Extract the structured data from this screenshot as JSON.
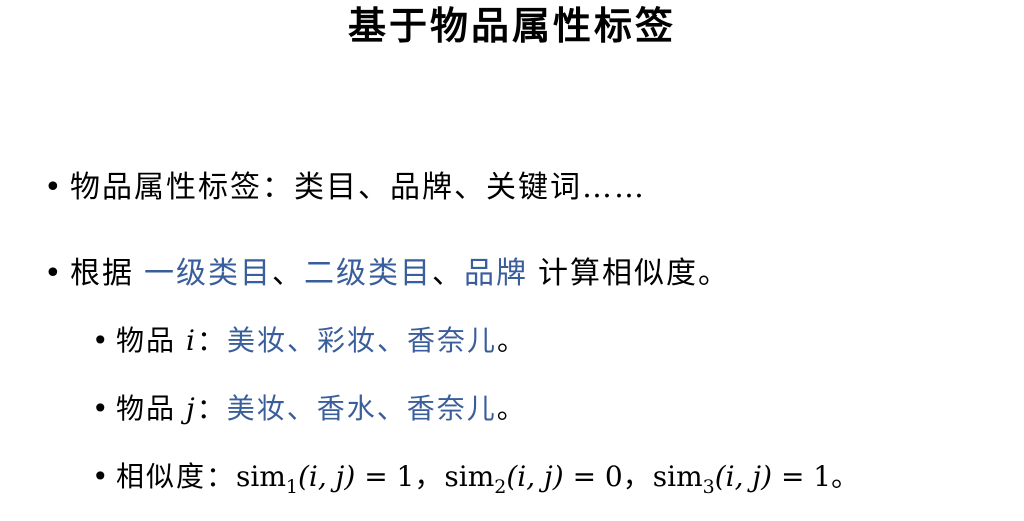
{
  "title": "基于物品属性标签",
  "bullets": {
    "b1": {
      "marker": "•",
      "text": "物品属性标签：类目、品牌、关键词……"
    },
    "b2": {
      "marker": "•",
      "prefix": "根据",
      "term1": "一级类目",
      "sep1": "、",
      "term2": "二级类目",
      "sep2": "、",
      "term3": "品牌",
      "suffix": "计算相似度。"
    }
  },
  "sub_bullets": {
    "s1": {
      "marker": "•",
      "label": "物品",
      "var": "i",
      "colon": "：",
      "values": "美妆、彩妆、香奈儿",
      "end": "。"
    },
    "s2": {
      "marker": "•",
      "label": "物品",
      "var": "j",
      "colon": "：",
      "values": "美妆、香水、香奈儿",
      "end": "。"
    },
    "s3": {
      "marker": "•",
      "label": "相似度：",
      "sim_name": "sim",
      "sub1": "1",
      "args": "(i, j)",
      "eq1": "= 1",
      "sep1": "，",
      "sub2": "2",
      "eq2": "= 0",
      "sep2": "，",
      "sub3": "3",
      "eq3": "= 1",
      "end": "。"
    }
  },
  "colors": {
    "accent_blue": "#3A5E9B",
    "text": "#000000",
    "background": "#FFFFFF"
  }
}
